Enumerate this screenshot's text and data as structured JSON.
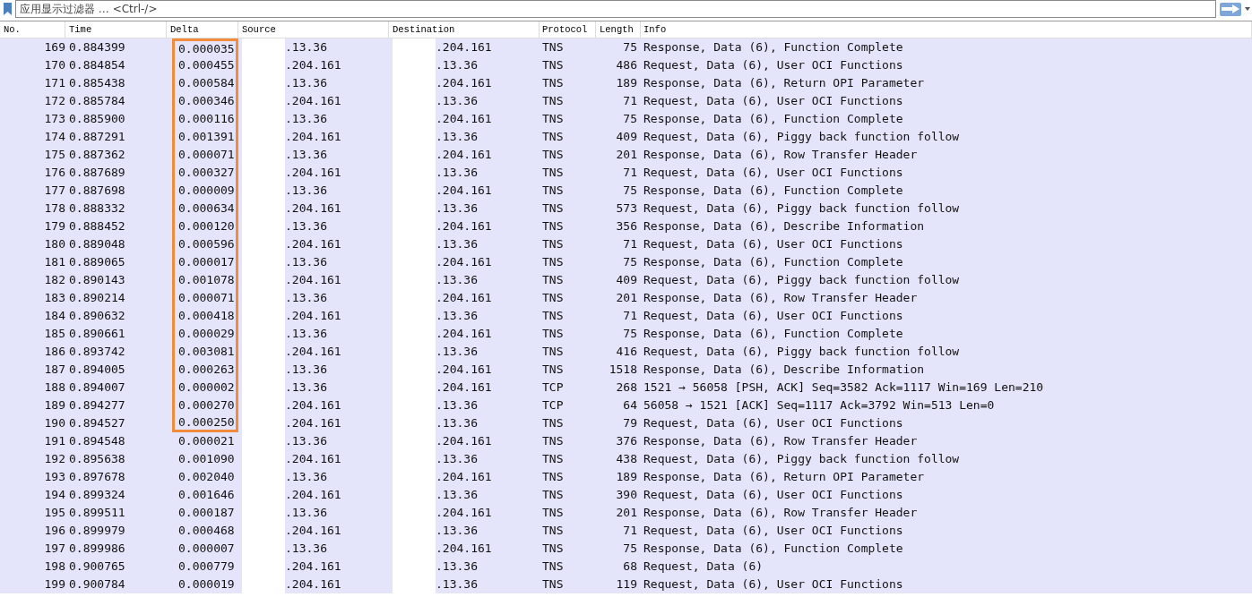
{
  "filter_bar": {
    "placeholder": "应用显示过滤器 … <Ctrl-/>"
  },
  "table": {
    "columns": [
      "No.",
      "Time",
      "Delta",
      "Source",
      "Destination",
      "Protocol",
      "Length",
      "Info"
    ],
    "rows": [
      {
        "no": "169",
        "time": "0.884399",
        "delta": "0.000035",
        "source": ".13.36",
        "destination": ".204.161",
        "protocol": "TNS",
        "length": "75",
        "info": "Response, Data (6), Function Complete",
        "highlighted": true
      },
      {
        "no": "170",
        "time": "0.884854",
        "delta": "0.000455",
        "source": ".204.161",
        "destination": ".13.36",
        "protocol": "TNS",
        "length": "486",
        "info": "Request, Data (6), User OCI Functions",
        "highlighted": true
      },
      {
        "no": "171",
        "time": "0.885438",
        "delta": "0.000584",
        "source": ".13.36",
        "destination": ".204.161",
        "protocol": "TNS",
        "length": "189",
        "info": "Response, Data (6), Return OPI Parameter",
        "highlighted": true
      },
      {
        "no": "172",
        "time": "0.885784",
        "delta": "0.000346",
        "source": ".204.161",
        "destination": ".13.36",
        "protocol": "TNS",
        "length": "71",
        "info": "Request, Data (6), User OCI Functions",
        "highlighted": true
      },
      {
        "no": "173",
        "time": "0.885900",
        "delta": "0.000116",
        "source": ".13.36",
        "destination": ".204.161",
        "protocol": "TNS",
        "length": "75",
        "info": "Response, Data (6), Function Complete",
        "highlighted": true
      },
      {
        "no": "174",
        "time": "0.887291",
        "delta": "0.001391",
        "source": ".204.161",
        "destination": ".13.36",
        "protocol": "TNS",
        "length": "409",
        "info": "Request, Data (6), Piggy back function follow",
        "highlighted": true
      },
      {
        "no": "175",
        "time": "0.887362",
        "delta": "0.000071",
        "source": ".13.36",
        "destination": ".204.161",
        "protocol": "TNS",
        "length": "201",
        "info": "Response, Data (6), Row Transfer Header",
        "highlighted": true
      },
      {
        "no": "176",
        "time": "0.887689",
        "delta": "0.000327",
        "source": ".204.161",
        "destination": ".13.36",
        "protocol": "TNS",
        "length": "71",
        "info": "Request, Data (6), User OCI Functions",
        "highlighted": true
      },
      {
        "no": "177",
        "time": "0.887698",
        "delta": "0.000009",
        "source": ".13.36",
        "destination": ".204.161",
        "protocol": "TNS",
        "length": "75",
        "info": "Response, Data (6), Function Complete",
        "highlighted": true
      },
      {
        "no": "178",
        "time": "0.888332",
        "delta": "0.000634",
        "source": ".204.161",
        "destination": ".13.36",
        "protocol": "TNS",
        "length": "573",
        "info": "Request, Data (6), Piggy back function follow",
        "highlighted": true
      },
      {
        "no": "179",
        "time": "0.888452",
        "delta": "0.000120",
        "source": ".13.36",
        "destination": ".204.161",
        "protocol": "TNS",
        "length": "356",
        "info": "Response, Data (6), Describe Information",
        "highlighted": true
      },
      {
        "no": "180",
        "time": "0.889048",
        "delta": "0.000596",
        "source": ".204.161",
        "destination": ".13.36",
        "protocol": "TNS",
        "length": "71",
        "info": "Request, Data (6), User OCI Functions",
        "highlighted": true
      },
      {
        "no": "181",
        "time": "0.889065",
        "delta": "0.000017",
        "source": ".13.36",
        "destination": ".204.161",
        "protocol": "TNS",
        "length": "75",
        "info": "Response, Data (6), Function Complete",
        "highlighted": true
      },
      {
        "no": "182",
        "time": "0.890143",
        "delta": "0.001078",
        "source": ".204.161",
        "destination": ".13.36",
        "protocol": "TNS",
        "length": "409",
        "info": "Request, Data (6), Piggy back function follow",
        "highlighted": true
      },
      {
        "no": "183",
        "time": "0.890214",
        "delta": "0.000071",
        "source": ".13.36",
        "destination": ".204.161",
        "protocol": "TNS",
        "length": "201",
        "info": "Response, Data (6), Row Transfer Header",
        "highlighted": true
      },
      {
        "no": "184",
        "time": "0.890632",
        "delta": "0.000418",
        "source": ".204.161",
        "destination": ".13.36",
        "protocol": "TNS",
        "length": "71",
        "info": "Request, Data (6), User OCI Functions",
        "highlighted": true
      },
      {
        "no": "185",
        "time": "0.890661",
        "delta": "0.000029",
        "source": ".13.36",
        "destination": ".204.161",
        "protocol": "TNS",
        "length": "75",
        "info": "Response, Data (6), Function Complete",
        "highlighted": true
      },
      {
        "no": "186",
        "time": "0.893742",
        "delta": "0.003081",
        "source": ".204.161",
        "destination": ".13.36",
        "protocol": "TNS",
        "length": "416",
        "info": "Request, Data (6), Piggy back function follow",
        "highlighted": true
      },
      {
        "no": "187",
        "time": "0.894005",
        "delta": "0.000263",
        "source": ".13.36",
        "destination": ".204.161",
        "protocol": "TNS",
        "length": "1518",
        "info": "Response, Data (6), Describe Information",
        "highlighted": true
      },
      {
        "no": "188",
        "time": "0.894007",
        "delta": "0.000002",
        "source": ".13.36",
        "destination": ".204.161",
        "protocol": "TCP",
        "length": "268",
        "info": "1521 → 56058 [PSH, ACK] Seq=3582 Ack=1117 Win=169 Len=210",
        "highlighted": true
      },
      {
        "no": "189",
        "time": "0.894277",
        "delta": "0.000270",
        "source": ".204.161",
        "destination": ".13.36",
        "protocol": "TCP",
        "length": "64",
        "info": "56058 → 1521 [ACK] Seq=1117 Ack=3792 Win=513 Len=0",
        "highlighted": true
      },
      {
        "no": "190",
        "time": "0.894527",
        "delta": "0.000250",
        "source": ".204.161",
        "destination": ".13.36",
        "protocol": "TNS",
        "length": "79",
        "info": "Request, Data (6), User OCI Functions",
        "highlighted": true
      },
      {
        "no": "191",
        "time": "0.894548",
        "delta": "0.000021",
        "source": ".13.36",
        "destination": ".204.161",
        "protocol": "TNS",
        "length": "376",
        "info": "Response, Data (6), Row Transfer Header",
        "highlighted": false
      },
      {
        "no": "192",
        "time": "0.895638",
        "delta": "0.001090",
        "source": ".204.161",
        "destination": ".13.36",
        "protocol": "TNS",
        "length": "438",
        "info": "Request, Data (6), Piggy back function follow",
        "highlighted": false
      },
      {
        "no": "193",
        "time": "0.897678",
        "delta": "0.002040",
        "source": ".13.36",
        "destination": ".204.161",
        "protocol": "TNS",
        "length": "189",
        "info": "Response, Data (6), Return OPI Parameter",
        "highlighted": false
      },
      {
        "no": "194",
        "time": "0.899324",
        "delta": "0.001646",
        "source": ".204.161",
        "destination": ".13.36",
        "protocol": "TNS",
        "length": "390",
        "info": "Request, Data (6), User OCI Functions",
        "highlighted": false
      },
      {
        "no": "195",
        "time": "0.899511",
        "delta": "0.000187",
        "source": ".13.36",
        "destination": ".204.161",
        "protocol": "TNS",
        "length": "201",
        "info": "Response, Data (6), Row Transfer Header",
        "highlighted": false
      },
      {
        "no": "196",
        "time": "0.899979",
        "delta": "0.000468",
        "source": ".204.161",
        "destination": ".13.36",
        "protocol": "TNS",
        "length": "71",
        "info": "Request, Data (6), User OCI Functions",
        "highlighted": false
      },
      {
        "no": "197",
        "time": "0.899986",
        "delta": "0.000007",
        "source": ".13.36",
        "destination": ".204.161",
        "protocol": "TNS",
        "length": "75",
        "info": "Response, Data (6), Function Complete",
        "highlighted": false
      },
      {
        "no": "198",
        "time": "0.900765",
        "delta": "0.000779",
        "source": ".204.161",
        "destination": ".13.36",
        "protocol": "TNS",
        "length": "68",
        "info": "Request, Data (6)",
        "highlighted": false
      },
      {
        "no": "199",
        "time": "0.900784",
        "delta": "0.000019",
        "source": ".204.161",
        "destination": ".13.36",
        "protocol": "TNS",
        "length": "119",
        "info": "Request, Data (6), User OCI Functions",
        "highlighted": false
      }
    ]
  }
}
